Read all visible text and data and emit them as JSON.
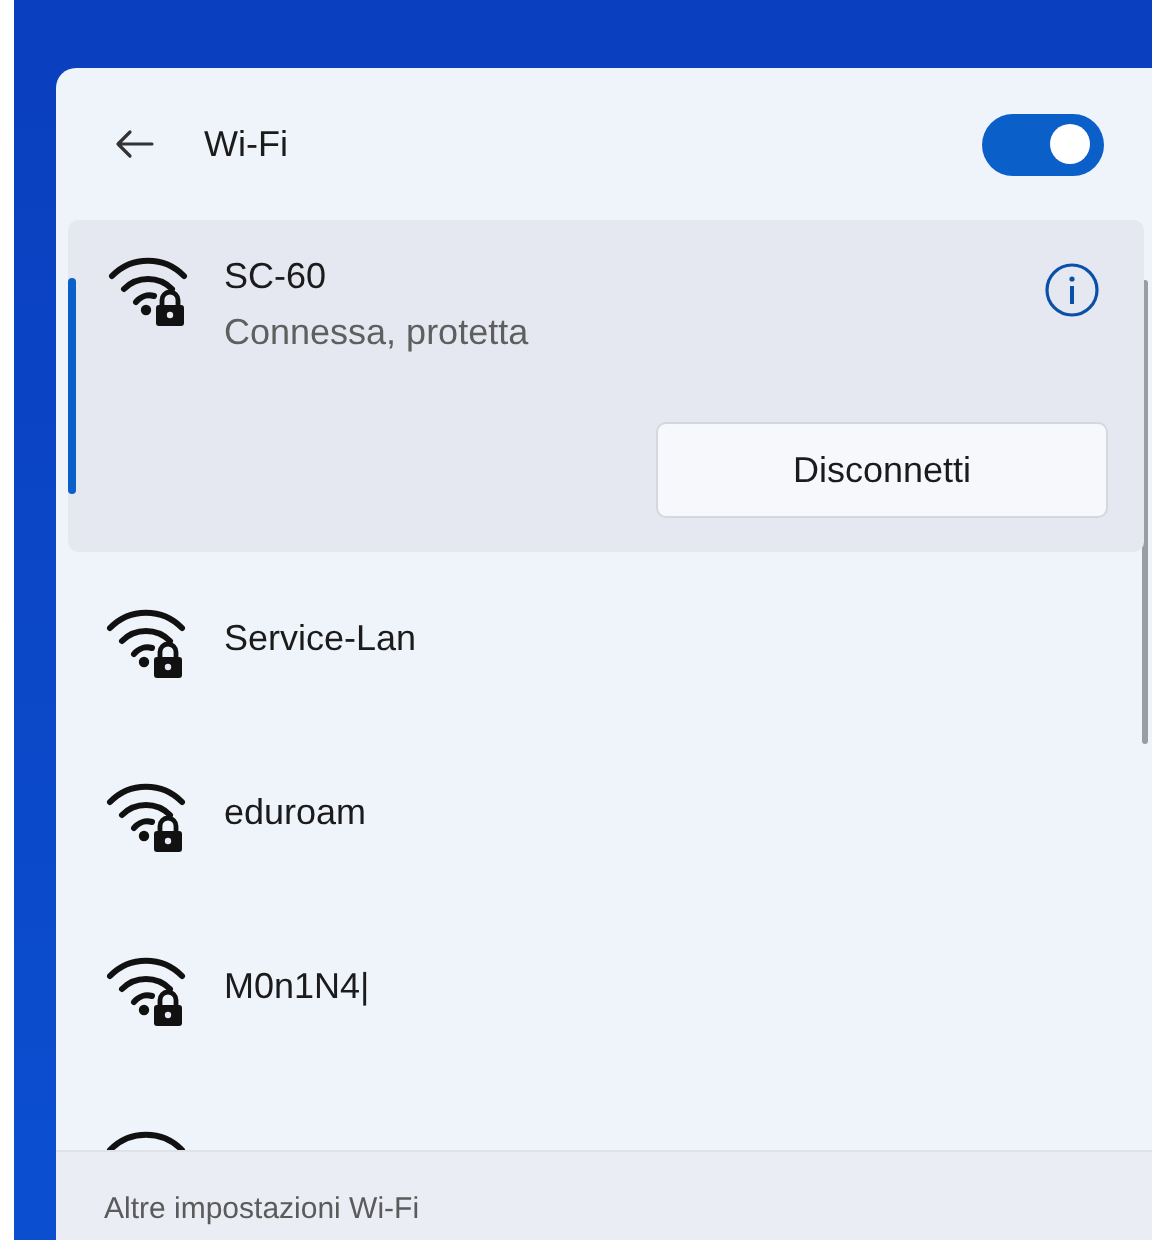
{
  "header": {
    "title": "Wi-Fi",
    "wifi_on": true
  },
  "networks": [
    {
      "name": "SC-60",
      "status": "Connessa, protetta",
      "selected": true,
      "button": "Disconnetti"
    },
    {
      "name": "Service-Lan",
      "selected": false
    },
    {
      "name": "eduroam",
      "selected": false
    },
    {
      "name": "M0n1N4|",
      "selected": false
    },
    {
      "selected": false
    }
  ],
  "footer": {
    "link": "Altre impostazioni Wi-Fi"
  }
}
